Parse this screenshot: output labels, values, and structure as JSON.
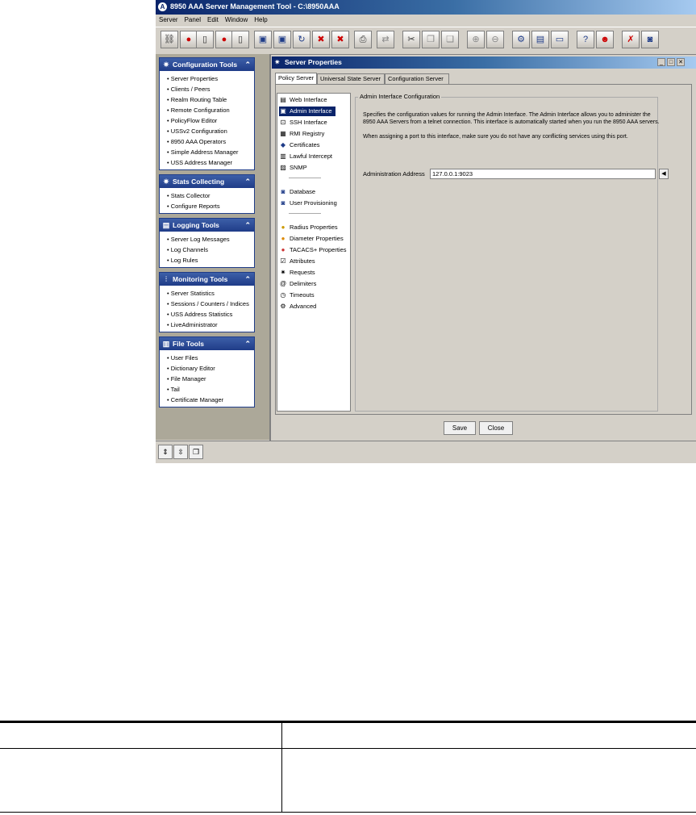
{
  "window": {
    "title": "8950 AAA Server Management Tool - C:\\8950AAA"
  },
  "menu": [
    "Server",
    "Panel",
    "Edit",
    "Window",
    "Help"
  ],
  "toolbar": {
    "icons": [
      "connect-icon",
      "record-red-icon",
      "server-icon",
      "record-red-icon",
      "server-icon",
      "save-icon",
      "save-all-icon",
      "refresh-icon",
      "close-window-icon",
      "delete-icon",
      "print-icon",
      "sync-icon",
      "cut-icon",
      "copy-icon",
      "paste-icon",
      "zoom-in-icon",
      "zoom-out-icon",
      "settings-icon",
      "document-icon",
      "monitor-icon",
      "help-icon",
      "user-icon",
      "tools-icon",
      "database-icon"
    ]
  },
  "sidebar": {
    "panels": [
      {
        "title": "Configuration Tools",
        "items": [
          "Server Properties",
          "Clients / Peers",
          "Realm Routing Table",
          "Remote Configuration",
          "PolicyFlow Editor",
          "USSv2 Configuration",
          "8950 AAA Operators",
          "Simple Address Manager",
          "USS Address Manager"
        ]
      },
      {
        "title": "Stats Collecting",
        "items": [
          "Stats Collector",
          "Configure Reports"
        ]
      },
      {
        "title": "Logging Tools",
        "items": [
          "Server Log Messages",
          "Log Channels",
          "Log Rules"
        ]
      },
      {
        "title": "Monitoring Tools",
        "items": [
          "Server Statistics",
          "Sessions / Counters / Indices",
          "USS Address Statistics",
          "LiveAdministrator"
        ]
      },
      {
        "title": "File Tools",
        "items": [
          "User Files",
          "Dictionary Editor",
          "File Manager",
          "Tail",
          "Certificate Manager"
        ]
      }
    ]
  },
  "server_properties": {
    "title": "Server Properties",
    "tabs": [
      "Policy Server",
      "Universal State Server",
      "Configuration Server"
    ],
    "nav": [
      "Web Interface",
      "Admin Interface",
      "SSH Interface",
      "RMI Registry",
      "Certificates",
      "Lawful Intercept",
      "SNMP",
      "Database",
      "User Provisioning",
      "Radius Properties",
      "Diameter Properties",
      "TACACS+ Properties",
      "Attributes",
      "Requests",
      "Delimiters",
      "Timeouts",
      "Advanced"
    ],
    "group_title": "Admin Interface Configuration",
    "desc1": "Specifies the configuration values for running the Admin Interface. The Admin Interface allows you to administer the 8950 AAA Servers from a telnet connection. This interface is automatically started when you run the 8950 AAA servers.",
    "desc2": "When assigning a port to this interface, make sure you do not have any conflicting services using this port.",
    "address_label": "Administration Address",
    "address_value": "127.0.0.1:9023",
    "save": "Save",
    "close": "Close"
  }
}
